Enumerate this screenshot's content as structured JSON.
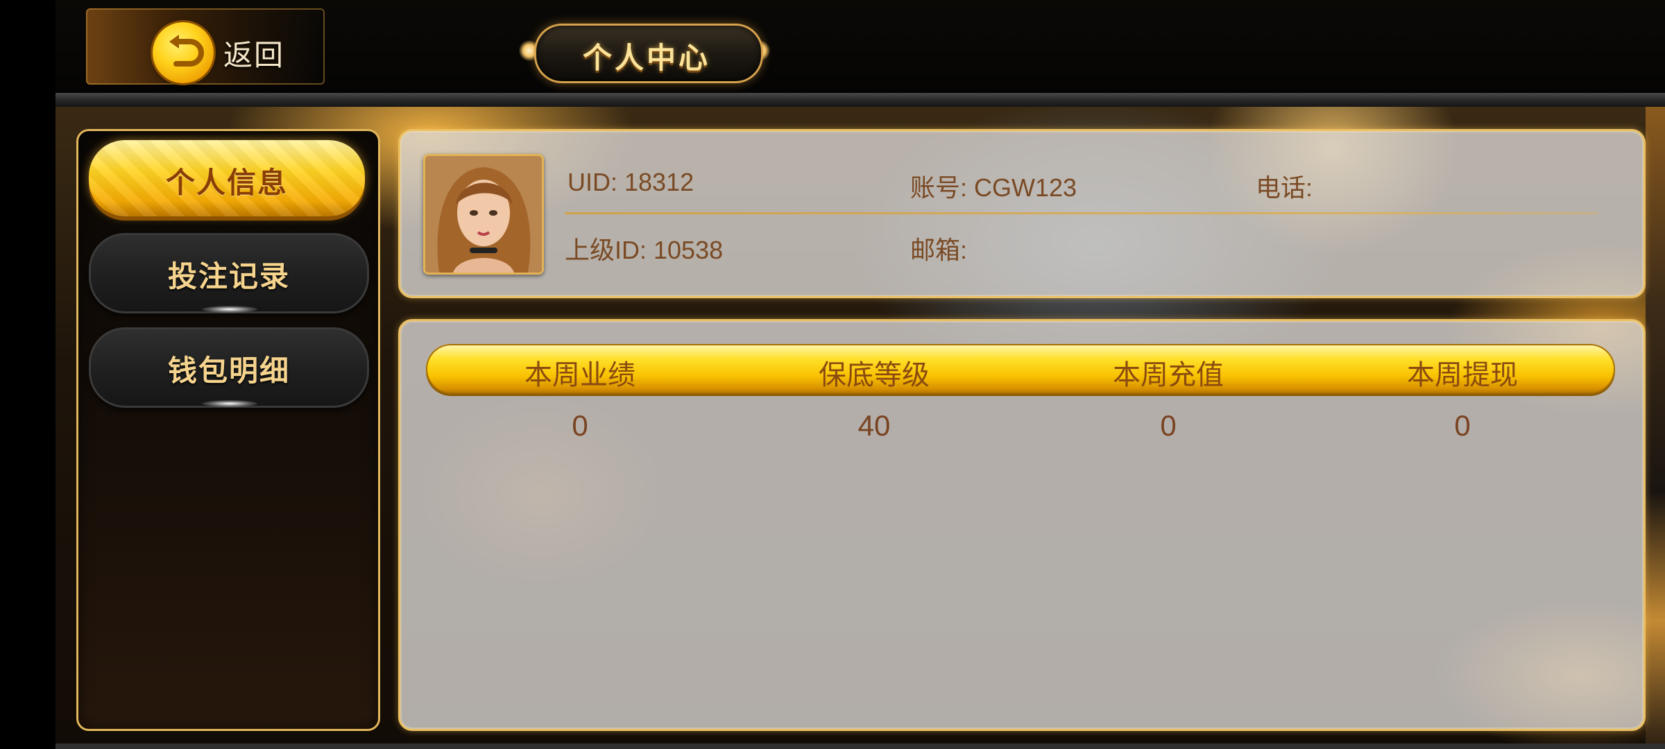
{
  "header": {
    "back_label": "返回",
    "title": "个人中心"
  },
  "sidebar": {
    "items": [
      {
        "label": "个人信息",
        "active": true
      },
      {
        "label": "投注记录",
        "active": false
      },
      {
        "label": "钱包明细",
        "active": false
      }
    ]
  },
  "profile": {
    "uid": "UID: 18312",
    "account": "账号: CGW123",
    "phone": "电话:",
    "parent_id": "上级ID: 10538",
    "email": "邮箱:"
  },
  "stats": {
    "headers": [
      "本周业绩",
      "保底等级",
      "本周充值",
      "本周提现"
    ],
    "values": [
      "0",
      "40",
      "0",
      "0"
    ]
  },
  "colors": {
    "accent_gold": "#ecc062",
    "active_tab": "#ffd425",
    "text_brown": "#7a4a24"
  }
}
